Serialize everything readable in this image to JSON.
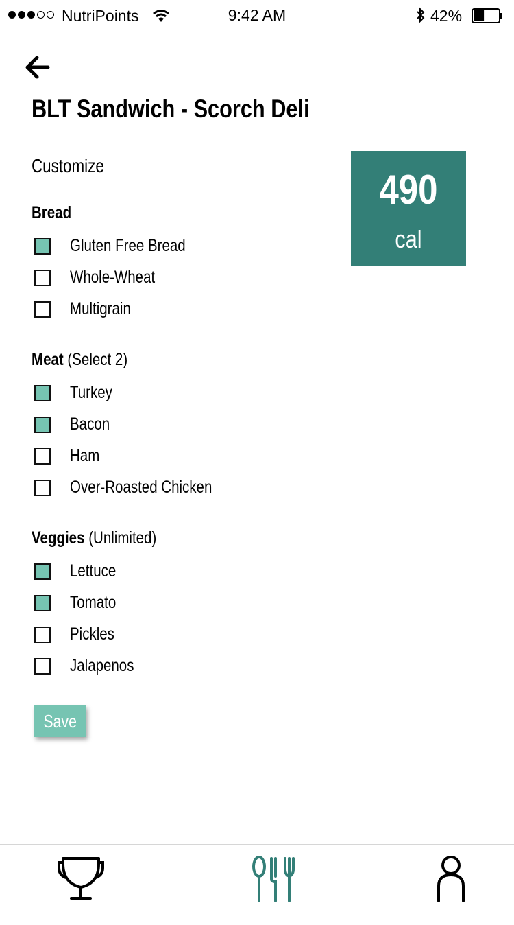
{
  "status_bar": {
    "carrier": "NutriPoints",
    "time": "9:42 AM",
    "battery": "42%",
    "battery_level": 0.42
  },
  "header": {
    "title": "BLT Sandwich - Scorch Deli"
  },
  "customize_label": "Customize",
  "calories": {
    "value": "490",
    "unit": "cal",
    "color": "#337f77"
  },
  "sections": {
    "bread": {
      "heading": "Bread",
      "note": "",
      "options": [
        {
          "label": "Gluten Free Bread",
          "checked": true
        },
        {
          "label": "Whole-Wheat",
          "checked": false
        },
        {
          "label": "Multigrain",
          "checked": false
        }
      ]
    },
    "meat": {
      "heading": "Meat",
      "note": "(Select 2)",
      "options": [
        {
          "label": "Turkey",
          "checked": true
        },
        {
          "label": "Bacon",
          "checked": true
        },
        {
          "label": "Ham",
          "checked": false
        },
        {
          "label": "Over-Roasted Chicken",
          "checked": false
        }
      ]
    },
    "veggies": {
      "heading": "Veggies",
      "note": "(Unlimited)",
      "options": [
        {
          "label": "Lettuce",
          "checked": true
        },
        {
          "label": "Tomato",
          "checked": true
        },
        {
          "label": "Pickles",
          "checked": false
        },
        {
          "label": "Jalapenos",
          "checked": false
        }
      ]
    }
  },
  "save_label": "Save",
  "accent_color": "#76c4b2",
  "tab_bar": {
    "tabs": [
      {
        "icon": "trophy-icon",
        "active": false
      },
      {
        "icon": "utensils-icon",
        "active": true
      },
      {
        "icon": "person-icon",
        "active": false
      }
    ]
  }
}
